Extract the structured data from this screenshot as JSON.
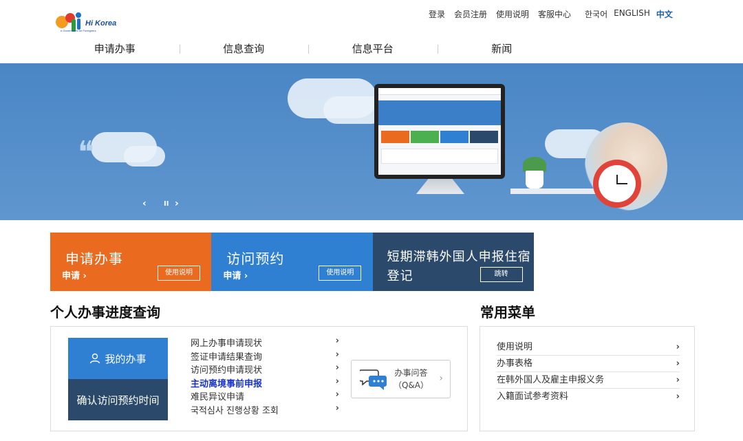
{
  "header": {
    "logo_text": "Hi Korea",
    "logo_tagline": "e-Government for Foreigners",
    "utility_links": [
      "登录",
      "会员注册",
      "使用说明",
      "客服中心"
    ],
    "languages": [
      "한국어",
      "ENGLISH",
      "中文"
    ],
    "active_language": "中文",
    "nav": [
      "申请办事",
      "信息查询",
      "信息平台",
      "新闻"
    ]
  },
  "banner": {
    "prev_label": "‹",
    "pause_label": "II",
    "next_label": "›"
  },
  "tiles": [
    {
      "title": "申请办事",
      "link": "申请 ›",
      "button": "使用说明",
      "color": "#ea6a1f"
    },
    {
      "title": "访问预约",
      "link": "申请 ›",
      "button": "使用说明",
      "color": "#2f7fd3"
    },
    {
      "title": "短期滞韩外国人申报住宿登记",
      "button": "跳转",
      "color": "#2b4a6b"
    }
  ],
  "progress": {
    "title": "个人办事进度查询",
    "my_affairs": "我的办事",
    "confirm_visit": "确认访问预约时间",
    "links": [
      "网上办事申请现状",
      "签证申请结果查询",
      "访问预约申请现状",
      "主动离境事前申报",
      "难民异议申请",
      "국적심사 진행상황 조회"
    ],
    "highlight_index": 3,
    "qa_line1": "办事问答",
    "qa_line2": "（Q&A）"
  },
  "menu": {
    "title": "常用菜单",
    "items": [
      "使用说明",
      "办事表格",
      "在韩外国人及雇主申报义务",
      "入籍面试参考资料"
    ]
  },
  "colors": {
    "accent": "#1a5fb4",
    "banner_bg": "#4a86c5",
    "orange": "#ea6a1f",
    "blue": "#2f7fd3",
    "navy": "#2b4a6b"
  }
}
